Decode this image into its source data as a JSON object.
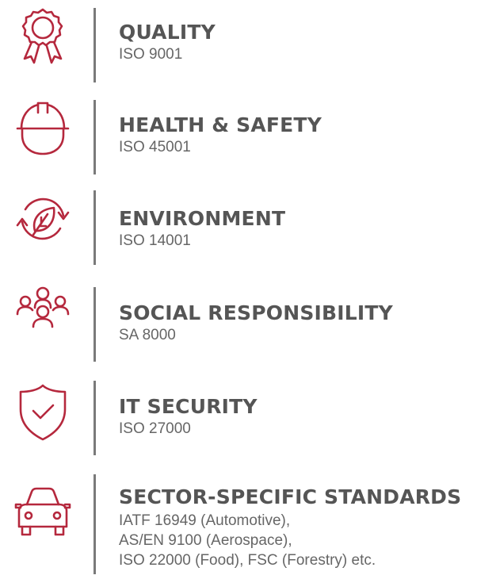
{
  "accent_color": "#b5283d",
  "text_color": "#555555",
  "items": [
    {
      "icon": "ribbon-award-icon",
      "title": "QUALITY",
      "lines": [
        "ISO 9001"
      ]
    },
    {
      "icon": "hard-hat-icon",
      "title": "HEALTH & SAFETY",
      "lines": [
        "ISO 45001"
      ]
    },
    {
      "icon": "leaf-cycle-icon",
      "title": "ENVIRONMENT",
      "lines": [
        "ISO 14001"
      ]
    },
    {
      "icon": "people-group-icon",
      "title": "SOCIAL RESPONSIBILITY",
      "lines": [
        "SA 8000"
      ]
    },
    {
      "icon": "shield-check-icon",
      "title": "IT SECURITY",
      "lines": [
        "ISO 27000"
      ]
    },
    {
      "icon": "car-icon",
      "title": "SECTOR-SPECIFIC STANDARDS",
      "lines": [
        "IATF 16949 (Automotive),",
        "AS/EN 9100 (Aerospace),",
        "ISO 22000 (Food), FSC (Forestry) etc."
      ]
    }
  ]
}
